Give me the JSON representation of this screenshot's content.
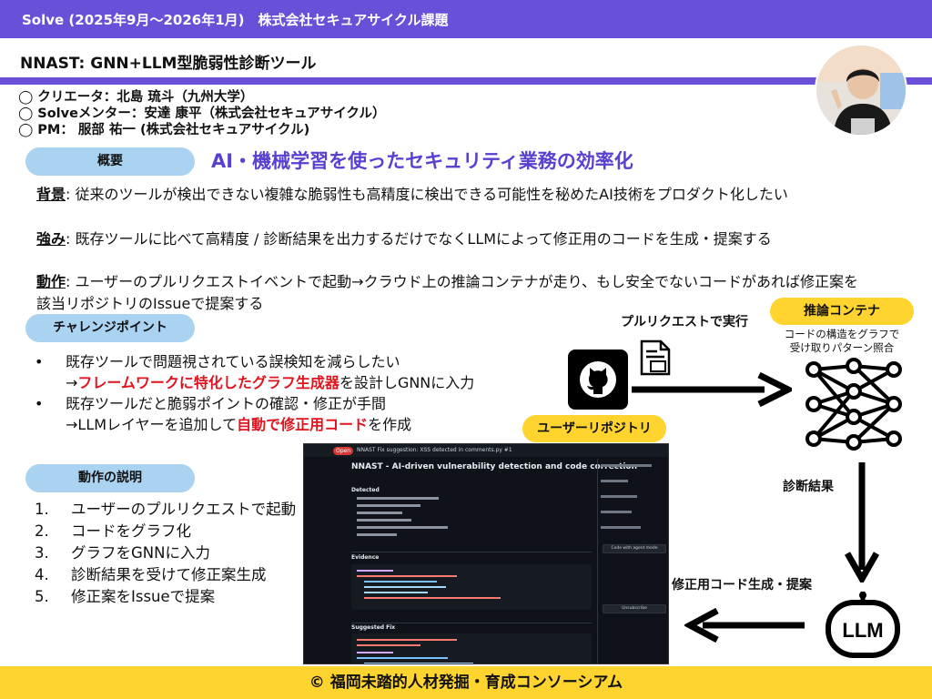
{
  "header": {
    "program": "Solve (2025年9月～2026年1月)　株式会社セキュアサイクル課題",
    "title": "NNAST: GNN+LLM型脆弱性診断ツール"
  },
  "credits": [
    "◯ クリエータ：北島 琉斗（九州大学）",
    "◯ Solveメンター：安達 康平（株式会社セキュアサイクル）",
    "◯ PM： 服部 祐一 (株式会社セキュアサイクル)"
  ],
  "overview": {
    "pill": "概要",
    "headline": "AI・機械学習を使ったセキュリティ業務の効率化",
    "background_label": "背景",
    "background_text": ": 従来のツールが検出できない複雑な脆弱性も高精度に検出できる可能性を秘めたAI技術をプロダクト化したい",
    "strength_label": "強み",
    "strength_text": ": 既存ツールに比べて高精度 / 診断結果を出力するだけでなくLLMによって修正用のコードを生成・提案する",
    "action_label": "動作",
    "action_text_1": ": ユーザーのプルリクエストイベントで起動→クラウド上の推論コンテナが走り、もし安全でないコードがあれば修正案を",
    "action_text_2": "該当リポジトリのIssueで提案する"
  },
  "challenge": {
    "pill": "チャレンジポイント",
    "b1": "既存ツールで問題視されている誤検知を減らしたい",
    "b1_pre": "→",
    "b1_red": "フレームワークに特化したグラフ生成器",
    "b1_post": "を設計しGNNに入力",
    "b2": "既存ツールだと脆弱ポイントの確認・修正が手間",
    "b2_pre": "→LLMレイヤーを追加して",
    "b2_red": "自動で修正用コード",
    "b2_post": "を作成"
  },
  "steps": {
    "pill": "動作の説明",
    "items": [
      "ユーザーのプルリクエストで起動",
      "コードをグラフ化",
      "グラフをGNNに入力",
      "診断結果を受けて修正案生成",
      "修正案をIssueで提案"
    ]
  },
  "diagram": {
    "pr_label": "プルリクエストで実行",
    "container_label": "推論コンテナ",
    "container_desc_1": "コードの構造をグラフで",
    "container_desc_2": "受け取りパターン照合",
    "repo_label": "ユーザーリポジトリ",
    "diag_label": "診断結果",
    "fix_label": "修正用コード生成・提案",
    "llm_text": "LLM"
  },
  "screenshot": {
    "badge": "Open",
    "issue_title": "NNAST Fix suggestion: XSS detected in comments.py #1",
    "heading": "NNAST - AI-driven vulnerability detection and code correction",
    "detected": "Detected",
    "evidence": "Evidence",
    "suggested": "Suggested Fix",
    "side_button": "Code with agent mode",
    "side_unsub": "Unsubscribe"
  },
  "footer": "© 福岡未踏的人材発掘・育成コンソーシアム"
}
